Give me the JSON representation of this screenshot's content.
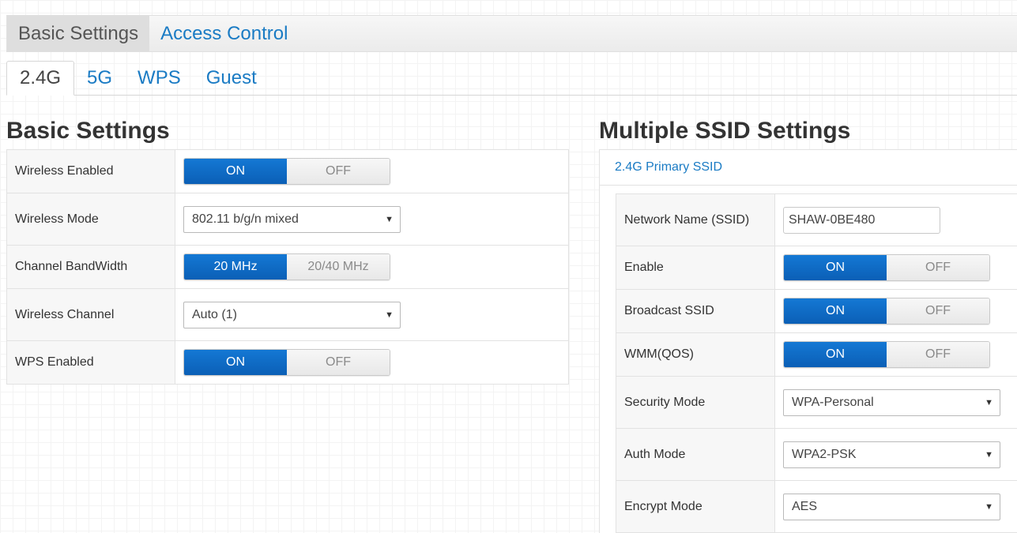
{
  "top_tabs": [
    {
      "label": "Basic Settings",
      "active": true
    },
    {
      "label": "Access Control",
      "active": false
    }
  ],
  "sub_tabs": [
    {
      "label": "2.4G",
      "active": true
    },
    {
      "label": "5G",
      "active": false
    },
    {
      "label": "WPS",
      "active": false
    },
    {
      "label": "Guest",
      "active": false
    }
  ],
  "basic": {
    "title": "Basic Settings",
    "wireless_enabled": {
      "label": "Wireless Enabled",
      "on": "ON",
      "off": "OFF",
      "value": "ON"
    },
    "wireless_mode": {
      "label": "Wireless Mode",
      "value": "802.11 b/g/n mixed"
    },
    "channel_bandwidth": {
      "label": "Channel BandWidth",
      "on": "20 MHz",
      "off": "20/40 MHz",
      "value": "20 MHz"
    },
    "wireless_channel": {
      "label": "Wireless Channel",
      "value": "Auto (1)"
    },
    "wps_enabled": {
      "label": "WPS Enabled",
      "on": "ON",
      "off": "OFF",
      "value": "ON"
    }
  },
  "ssid": {
    "title": "Multiple SSID Settings",
    "panel_header": "2.4G Primary SSID",
    "network_name": {
      "label": "Network Name (SSID)",
      "value": "SHAW-0BE480"
    },
    "enable": {
      "label": "Enable",
      "on": "ON",
      "off": "OFF",
      "value": "ON"
    },
    "broadcast_ssid": {
      "label": "Broadcast SSID",
      "on": "ON",
      "off": "OFF",
      "value": "ON"
    },
    "wmm": {
      "label": "WMM(QOS)",
      "on": "ON",
      "off": "OFF",
      "value": "ON"
    },
    "security_mode": {
      "label": "Security Mode",
      "value": "WPA-Personal"
    },
    "auth_mode": {
      "label": "Auth Mode",
      "value": "WPA2-PSK"
    },
    "encrypt_mode": {
      "label": "Encrypt Mode",
      "value": "AES"
    }
  },
  "colors": {
    "accent": "#1a7bc4",
    "toggle_on": "#0b66c3"
  },
  "icons": {
    "dropdown": "caret-down-icon"
  }
}
